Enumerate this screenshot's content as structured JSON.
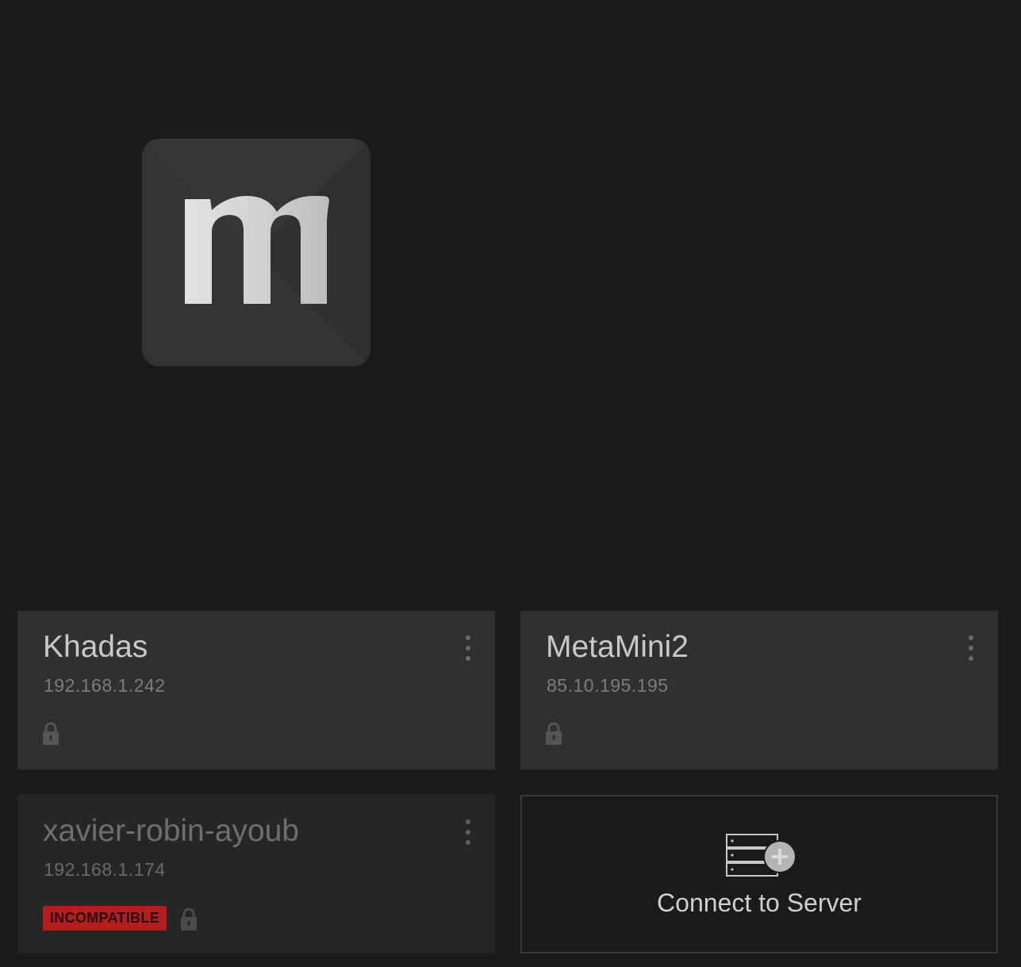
{
  "app": {
    "logo_letter": "m"
  },
  "servers": [
    {
      "name": "Khadas",
      "ip": "192.168.1.242",
      "locked": true,
      "compatible": true
    },
    {
      "name": "MetaMini2",
      "ip": "85.10.195.195",
      "locked": true,
      "compatible": true
    },
    {
      "name": "xavier-robin-ayoub",
      "ip": "192.168.1.174",
      "locked": true,
      "compatible": false,
      "badge": "INCOMPATIBLE"
    }
  ],
  "connect": {
    "label": "Connect to Server",
    "icon": "server-add-icon"
  },
  "colors": {
    "background": "#1b1b1b",
    "card": "#303030",
    "card_dim": "#262626",
    "badge": "#b41e1e",
    "text_primary": "#c8c8c8",
    "text_secondary": "#7c7c7c"
  }
}
